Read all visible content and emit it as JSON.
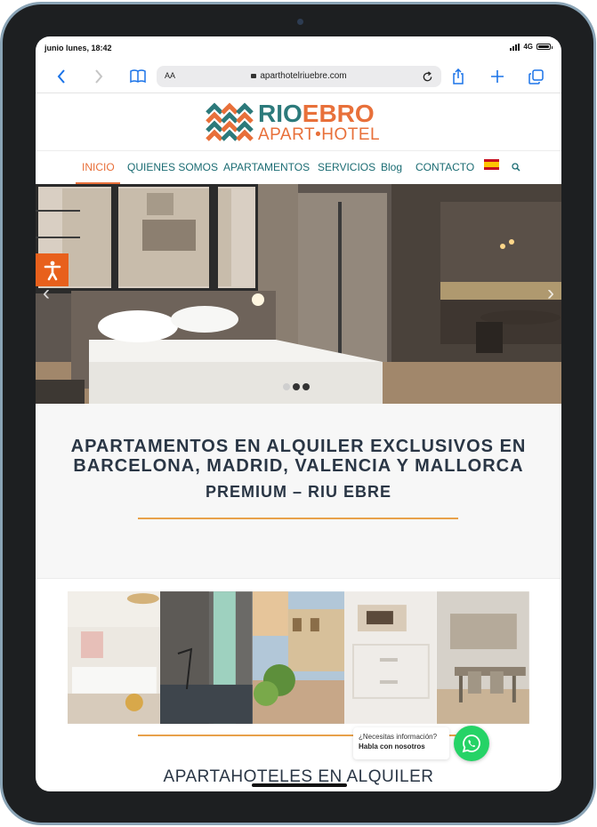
{
  "status_bar": {
    "time": "junio lunes, 18:42",
    "network": "4G"
  },
  "browser": {
    "text_size_label": "AA",
    "url": "aparthotelriuebre.com"
  },
  "logo": {
    "line1_a": "RIO",
    "line1_b": "EBRO",
    "line2": "APART•HOTEL"
  },
  "nav": {
    "items": [
      {
        "label": "INICIO",
        "active": true
      },
      {
        "label": "QUIENES SOMOS",
        "active": false
      },
      {
        "label": "APARTAMENTOS",
        "active": false
      },
      {
        "label": "SERVICIOS",
        "active": false
      },
      {
        "label": "Blog",
        "active": false
      },
      {
        "label": "CONTACTO",
        "active": false
      }
    ],
    "language_icon": "spain-flag-icon",
    "search_icon": "search-icon"
  },
  "hero": {
    "prev_arrow": "‹",
    "next_arrow": "›",
    "slide_dots": 3,
    "active_dot": 1
  },
  "heading": {
    "line1": "APARTAMENTOS EN ALQUILER EXCLUSIVOS EN",
    "line2": "BARCELONA, MADRID, VALENCIA Y MALLORCA",
    "line3": "PREMIUM – RIU EBRE"
  },
  "gallery": {
    "count": 5
  },
  "subheading": "APARTAHOTELES EN ALQUILER",
  "whatsapp": {
    "question": "¿Necesitas información?",
    "cta": "Habla con nosotros"
  },
  "colors": {
    "accent": "#e8703a",
    "teal": "#1b6c73",
    "whatsapp": "#25d366",
    "access": "#e8601c"
  }
}
